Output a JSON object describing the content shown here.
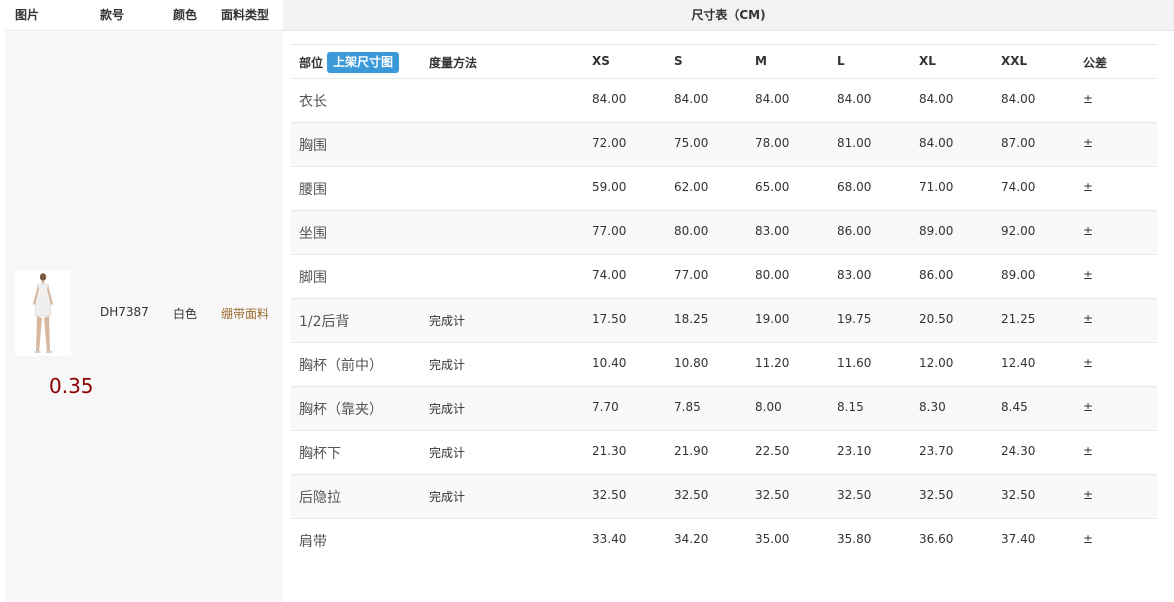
{
  "product_table": {
    "headers": {
      "image": "图片",
      "style": "款号",
      "color": "颜色",
      "fabric": "面料类型"
    },
    "row": {
      "image_value": "0.35",
      "style_no": "DH7387",
      "color": "白色",
      "fabric": "绷带面料"
    }
  },
  "size_chart": {
    "title": "尺寸表（CM)",
    "columns": {
      "part": "部位",
      "listing_button": "上架尺寸图",
      "method": "度量方法",
      "sizes": [
        "XS",
        "S",
        "M",
        "L",
        "XL",
        "XXL"
      ],
      "tolerance": "公差"
    },
    "rows": [
      {
        "part": "衣长",
        "method": "",
        "values": [
          "84.00",
          "84.00",
          "84.00",
          "84.00",
          "84.00",
          "84.00"
        ],
        "tolerance": "±"
      },
      {
        "part": "胸围",
        "method": "",
        "values": [
          "72.00",
          "75.00",
          "78.00",
          "81.00",
          "84.00",
          "87.00"
        ],
        "tolerance": "±"
      },
      {
        "part": "腰围",
        "method": "",
        "values": [
          "59.00",
          "62.00",
          "65.00",
          "68.00",
          "71.00",
          "74.00"
        ],
        "tolerance": "±"
      },
      {
        "part": "坐围",
        "method": "",
        "values": [
          "77.00",
          "80.00",
          "83.00",
          "86.00",
          "89.00",
          "92.00"
        ],
        "tolerance": "±"
      },
      {
        "part": "脚围",
        "method": "",
        "values": [
          "74.00",
          "77.00",
          "80.00",
          "83.00",
          "86.00",
          "89.00"
        ],
        "tolerance": "±"
      },
      {
        "part": "1/2后背",
        "method": "完成计",
        "values": [
          "17.50",
          "18.25",
          "19.00",
          "19.75",
          "20.50",
          "21.25"
        ],
        "tolerance": "±"
      },
      {
        "part": "胸杯（前中）",
        "method": "完成计",
        "values": [
          "10.40",
          "10.80",
          "11.20",
          "11.60",
          "12.00",
          "12.40"
        ],
        "tolerance": "±"
      },
      {
        "part": "胸杯（靠夹）",
        "method": "完成计",
        "values": [
          "7.70",
          "7.85",
          "8.00",
          "8.15",
          "8.30",
          "8.45"
        ],
        "tolerance": "±"
      },
      {
        "part": "胸杯下",
        "method": "完成计",
        "values": [
          "21.30",
          "21.90",
          "22.50",
          "23.10",
          "23.70",
          "24.30"
        ],
        "tolerance": "±"
      },
      {
        "part": "后隐拉",
        "method": "完成计",
        "values": [
          "32.50",
          "32.50",
          "32.50",
          "32.50",
          "32.50",
          "32.50"
        ],
        "tolerance": "±"
      },
      {
        "part": "肩带",
        "method": "",
        "values": [
          "33.40",
          "34.20",
          "35.00",
          "35.80",
          "36.60",
          "37.40"
        ],
        "tolerance": "±"
      }
    ]
  },
  "colors": {
    "accent": "#3a9ad9",
    "value_red": "#8b0000",
    "fabric_text": "#9b6b2c"
  }
}
